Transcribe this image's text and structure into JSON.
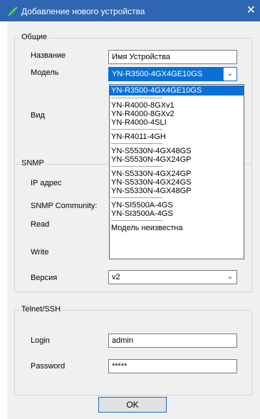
{
  "window": {
    "title": "Добавление нового устройства",
    "close_glyph": "✕"
  },
  "general": {
    "legend": "Общие",
    "name_label": "Название",
    "name_value": "Имя Устройства",
    "model_label": "Модель",
    "model_value": "YN-R3500-4GX4GE10GS",
    "view_label": "Вид"
  },
  "model_dropdown": {
    "items": [
      "YN-R3500-4GX4GE10GS",
      "------------------------------------",
      "YN-R4000-8GXv1",
      "YN-R4000-8GXv2",
      "YN-R4000-4SLI",
      "------------------------------------",
      "YN-R4011-4GH",
      "------------------------------------",
      "YN-S5530N-4GX48GS",
      "YN-S5530N-4GX24GP",
      "------------------------------------",
      "YN-S5330N-4GX24GP",
      "YN-S5330N-4GX24GS",
      "YN-S5330N-4GX48GP",
      "------------------------------------",
      "YN-SI5500A-4GS",
      "YN-SI3500A-4GS",
      "------------------------------------",
      "Модель неизвестна"
    ],
    "selected_index": 0
  },
  "snmp": {
    "legend": "SNMP",
    "ip_label": "IP адрес",
    "community_label": "SNMP Community:",
    "read_label": "Read",
    "write_label": "Write",
    "version_label": "Версия",
    "version_value": "v2"
  },
  "telnet": {
    "legend": "Telnet/SSH",
    "login_label": "Login",
    "login_value": "admin",
    "password_label": "Password",
    "password_value": "*****"
  },
  "ok_label": "OK",
  "colors": {
    "titlebar": "#2f66b1",
    "selection": "#0a70d8",
    "dialog_bg": "#f0f0f0"
  },
  "icons": {
    "app": "leaf-icon",
    "close": "close-icon",
    "dropdown": "chevron-down-icon"
  }
}
